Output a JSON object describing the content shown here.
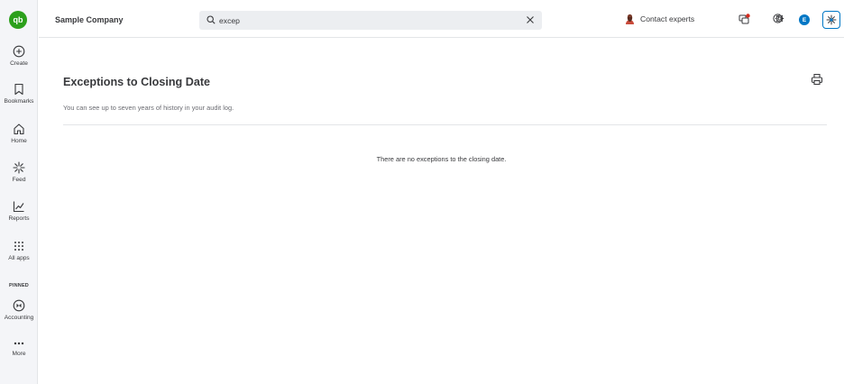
{
  "nav": {
    "logo_text": "qb",
    "items": [
      {
        "label": "Create",
        "icon": "plus-circle-icon"
      },
      {
        "label": "Bookmarks",
        "icon": "bookmark-icon"
      },
      {
        "label": "Home",
        "icon": "home-icon"
      },
      {
        "label": "Feed",
        "icon": "feed-icon"
      },
      {
        "label": "Reports",
        "icon": "reports-icon"
      },
      {
        "label": "All apps",
        "icon": "grid-icon"
      }
    ],
    "pinned_label": "PINNED",
    "pinned_items": [
      {
        "label": "Accounting",
        "icon": "accounting-icon"
      },
      {
        "label": "More",
        "icon": "more-icon"
      }
    ]
  },
  "header": {
    "company": "Sample Company",
    "search": {
      "value": "excep",
      "placeholder": ""
    },
    "contact_label": "Contact experts"
  },
  "user": {
    "initial": "E"
  },
  "main": {
    "title": "Exceptions to Closing Date",
    "subtitle": "You can see up to seven years of history in your audit log.",
    "empty_message": "There are no exceptions to the closing date."
  },
  "colors": {
    "brand_green": "#2ca01c",
    "accent_blue": "#0077c5"
  }
}
